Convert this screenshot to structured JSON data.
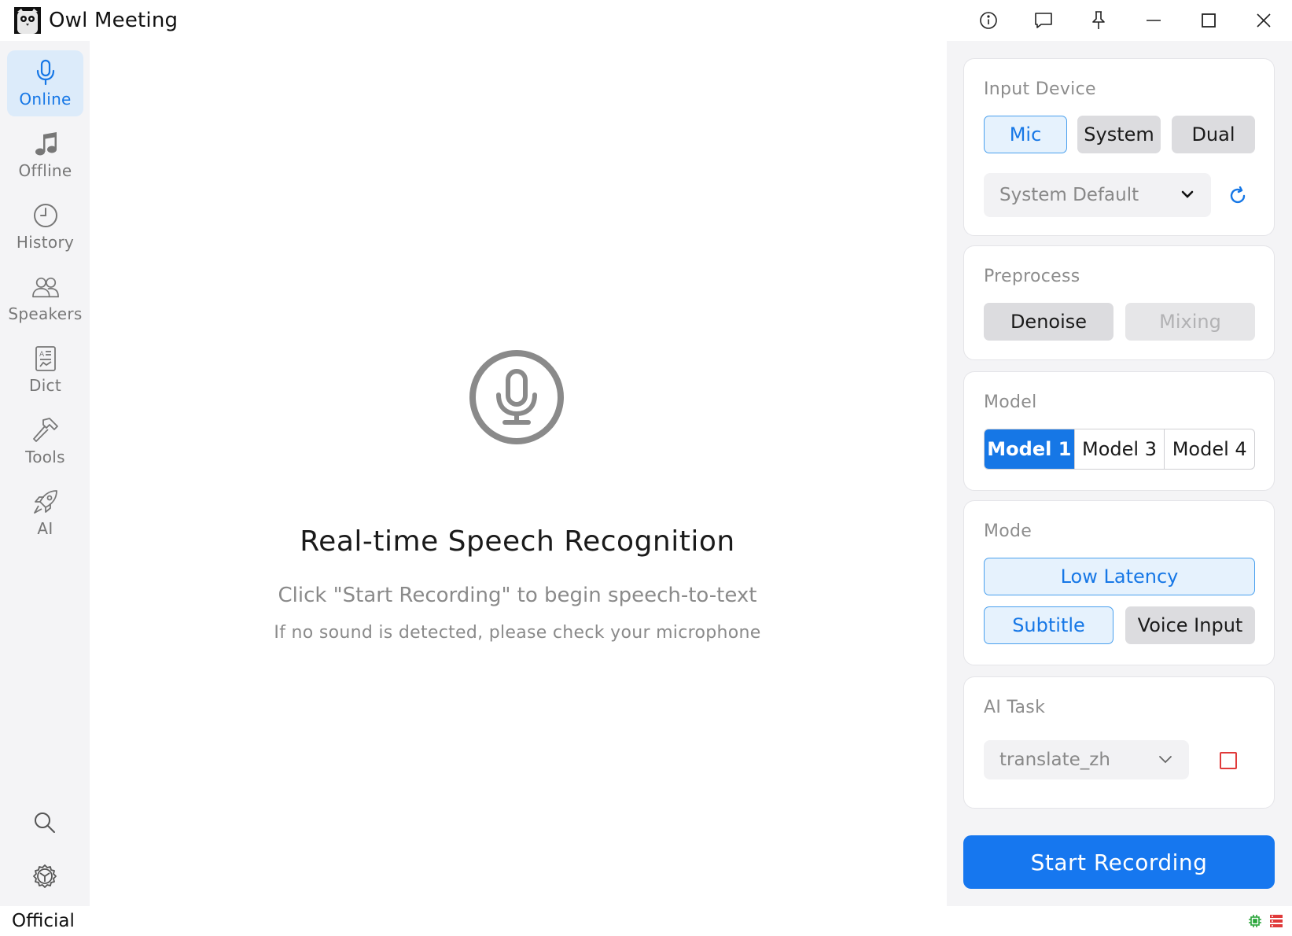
{
  "app": {
    "title": "Owl Meeting"
  },
  "titlebar": {
    "buttons": [
      "info-icon",
      "feedback-icon",
      "pin-icon",
      "minimize-icon",
      "maximize-icon",
      "close-icon"
    ]
  },
  "sidebar": {
    "items": [
      {
        "label": "Online",
        "icon": "microphone-icon",
        "active": true
      },
      {
        "label": "Offline",
        "icon": "music-note-icon",
        "active": false
      },
      {
        "label": "History",
        "icon": "clock-icon",
        "active": false
      },
      {
        "label": "Speakers",
        "icon": "people-icon",
        "active": false
      },
      {
        "label": "Dict",
        "icon": "dictionary-icon",
        "active": false
      },
      {
        "label": "Tools",
        "icon": "hammer-icon",
        "active": false
      },
      {
        "label": "AI",
        "icon": "rocket-icon",
        "active": false
      }
    ],
    "bottom": [
      "search-icon",
      "settings-icon"
    ]
  },
  "main": {
    "title": "Real-time Speech Recognition",
    "subtitle": "Click \"Start Recording\" to begin speech-to-text",
    "hint": "If no sound is detected, please check your microphone"
  },
  "panel": {
    "input_device": {
      "title": "Input Device",
      "options": [
        "Mic",
        "System",
        "Dual"
      ],
      "selected": "Mic",
      "device": "System Default"
    },
    "preprocess": {
      "title": "Preprocess",
      "denoise_label": "Denoise",
      "mixing_label": "Mixing"
    },
    "model": {
      "title": "Model",
      "options": [
        "Model 1",
        "Model 3",
        "Model 4"
      ],
      "selected": "Model 1"
    },
    "mode": {
      "title": "Mode",
      "low_latency": "Low Latency",
      "subtitle": "Subtitle",
      "voice_input": "Voice Input"
    },
    "ai_task": {
      "title": "AI Task",
      "task": "translate_zh",
      "enabled": false
    },
    "start_label": "Start Recording"
  },
  "status": {
    "text": "Official"
  },
  "colors": {
    "accent": "#1677e6",
    "selected_bg": "#e6f2fd",
    "panel_bg": "#f4f4f6",
    "checkbox_border": "#e03a3a"
  }
}
